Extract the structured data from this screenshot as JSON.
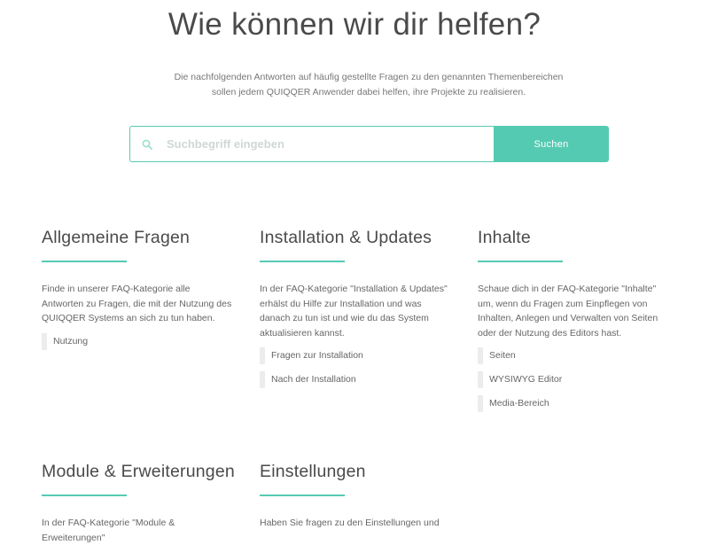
{
  "hero": {
    "title": "Wie können wir dir helfen?",
    "intro_line1": "Die nachfolgenden Antworten auf häufig gestellte Fragen zu den genannten Themenbereichen",
    "intro_line2": "sollen jedem QUIQQER Anwender dabei helfen, ihre Projekte zu  realisieren."
  },
  "search": {
    "placeholder": "Suchbegriff eingeben",
    "button_label": "Suchen",
    "icon": "search-icon"
  },
  "colors": {
    "accent": "#55cab2",
    "heading": "#4a4a4a",
    "text": "#666666",
    "link_bar": "#ececec"
  },
  "categories": [
    {
      "title": "Allgemeine Fragen",
      "description": "Finde in unserer FAQ-Kategorie alle Antworten zu Fragen, die mit der Nutzung des QUIQQER Systems an sich zu tun haben.",
      "links": [
        "Nutzung"
      ]
    },
    {
      "title": "Installation & Updates",
      "description": "In der FAQ-Kategorie \"Installation & Updates\" erhälst du Hilfe zur Installation und was danach zu tun ist und wie du das System aktualisieren kannst.",
      "links": [
        "Fragen zur Installation",
        "Nach der Installation"
      ]
    },
    {
      "title": "Inhalte",
      "description": "Schaue dich in der FAQ-Kategorie \"Inhalte\" um, wenn du Fragen zum Einpflegen von Inhalten, Anlegen und Verwalten von Seiten oder der Nutzung des Editors hast.",
      "links": [
        "Seiten",
        "WYSIWYG Editor",
        "Media-Bereich"
      ]
    },
    {
      "title": "Module & Erweiterungen",
      "description": "In der FAQ-Kategorie \"Module & Erweiterungen\"",
      "links": []
    },
    {
      "title": "Einstellungen",
      "description": "Haben Sie fragen zu den Einstellungen und",
      "links": []
    }
  ]
}
